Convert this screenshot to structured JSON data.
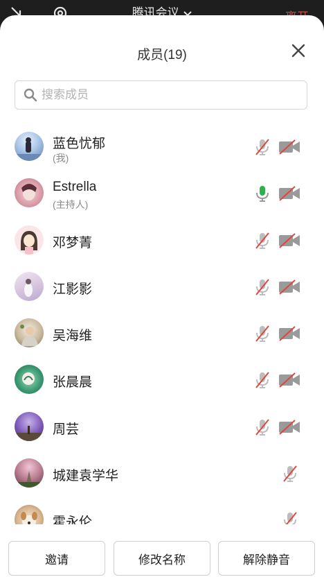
{
  "topbar": {
    "title": "腾讯会议",
    "leave_label": "离开"
  },
  "sheet": {
    "title": "成员(19)"
  },
  "search": {
    "placeholder": "搜索成员"
  },
  "members": [
    {
      "name": "蓝色忧郁",
      "tag": "(我)",
      "mic": "muted",
      "camera": "off"
    },
    {
      "name": "Estrella",
      "tag": "(主持人)",
      "mic": "active",
      "camera": "off"
    },
    {
      "name": "邓梦菁",
      "tag": "",
      "mic": "muted",
      "camera": "off"
    },
    {
      "name": "江影影",
      "tag": "",
      "mic": "muted",
      "camera": "off"
    },
    {
      "name": "吴海维",
      "tag": "",
      "mic": "muted",
      "camera": "off"
    },
    {
      "name": "张晨晨",
      "tag": "",
      "mic": "muted",
      "camera": "off"
    },
    {
      "name": "周芸",
      "tag": "",
      "mic": "muted",
      "camera": "off"
    },
    {
      "name": "城建袁学华",
      "tag": "",
      "mic": "muted",
      "camera": "none"
    },
    {
      "name": "霍永伦",
      "tag": "",
      "mic": "muted",
      "camera": "none"
    }
  ],
  "bottom": {
    "invite_label": "邀请",
    "rename_label": "修改名称",
    "unmute_all_label": "解除静音"
  },
  "colors": {
    "mute_slash": "#e0463e",
    "mic_active": "#2bb24c",
    "icon_gray": "#9a9a9a",
    "leave_text": "#e0463e"
  }
}
